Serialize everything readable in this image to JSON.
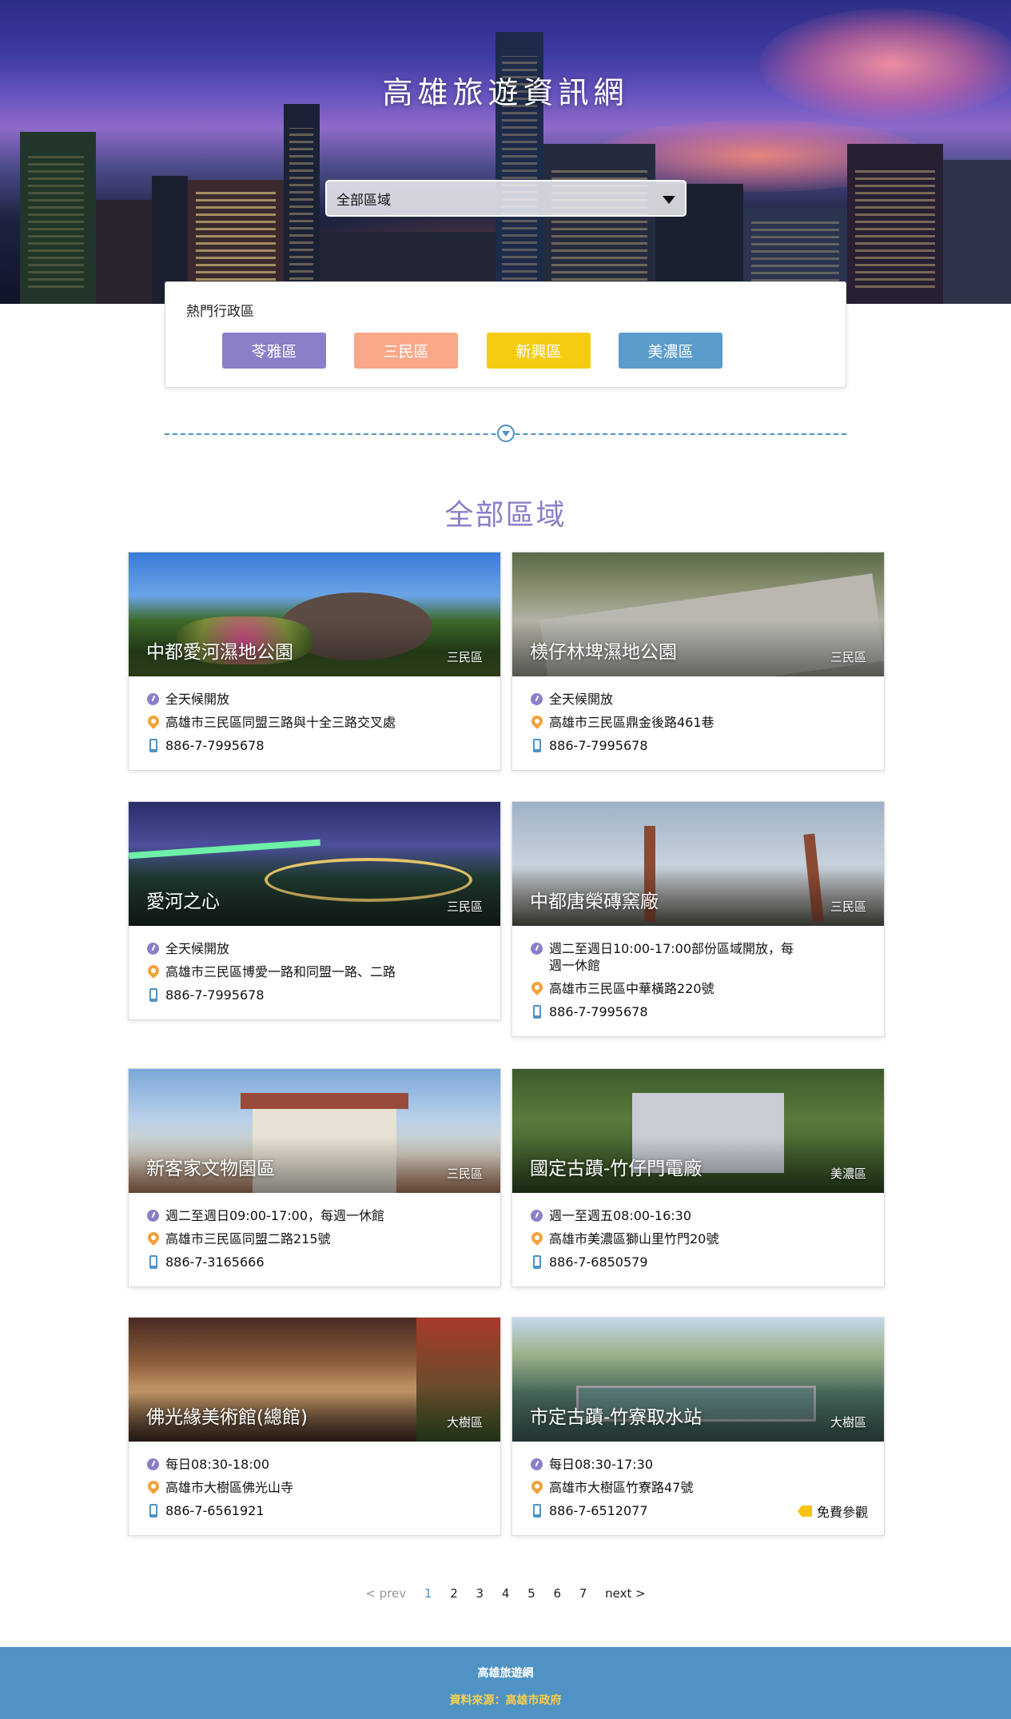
{
  "hero": {
    "title": "高雄旅遊資訊網",
    "select_value": "全部區域"
  },
  "hot_districts": {
    "title": "熱門行政區",
    "items": [
      {
        "label": "苓雅區",
        "color": "#8a7fc9"
      },
      {
        "label": "三民區",
        "color": "#f9a88a"
      },
      {
        "label": "新興區",
        "color": "#f5cc12"
      },
      {
        "label": "美濃區",
        "color": "#5a9ccc"
      }
    ]
  },
  "section_title": "全部區域",
  "cards": [
    {
      "name": "中都愛河濕地公園",
      "zone": "三民區",
      "hours": "全天候開放",
      "address": "高雄市三民區同盟三路與十全三路交叉處",
      "phone": "886-7-7995678"
    },
    {
      "name": "檨仔林埤濕地公園",
      "zone": "三民區",
      "hours": "全天候開放",
      "address": "高雄市三民區鼎金後路461巷",
      "phone": "886-7-7995678"
    },
    {
      "name": "愛河之心",
      "zone": "三民區",
      "hours": "全天候開放",
      "address": "高雄市三民區博愛一路和同盟一路、二路",
      "phone": "886-7-7995678"
    },
    {
      "name": "中都唐榮磚窯廠",
      "zone": "三民區",
      "hours": "週二至週日10:00-17:00部份區域開放，每週一休館",
      "address": "高雄市三民區中華橫路220號",
      "phone": "886-7-7995678"
    },
    {
      "name": "新客家文物園區",
      "zone": "三民區",
      "hours": "週二至週日09:00-17:00，每週一休館",
      "address": "高雄市三民區同盟二路215號",
      "phone": "886-7-3165666"
    },
    {
      "name": "國定古蹟-竹仔門電廠",
      "zone": "美濃區",
      "hours": "週一至週五08:00-16:30",
      "address": "高雄市美濃區獅山里竹門20號",
      "phone": "886-7-6850579"
    },
    {
      "name": "佛光緣美術館(總館)",
      "zone": "大樹區",
      "hours": "每日08:30-18:00",
      "address": "高雄市大樹區佛光山寺",
      "phone": "886-7-6561921"
    },
    {
      "name": "市定古蹟-竹寮取水站",
      "zone": "大樹區",
      "hours": "每日08:30-17:30",
      "address": "高雄市大樹區竹寮路47號",
      "phone": "886-7-6512077",
      "ticket": "免費參觀"
    }
  ],
  "pagination": {
    "prev": "< prev",
    "pages": [
      "1",
      "2",
      "3",
      "4",
      "5",
      "6",
      "7"
    ],
    "active": "1",
    "next": "next >"
  },
  "footer": {
    "title": "高雄旅遊網",
    "source": "資料來源：高雄市政府"
  }
}
